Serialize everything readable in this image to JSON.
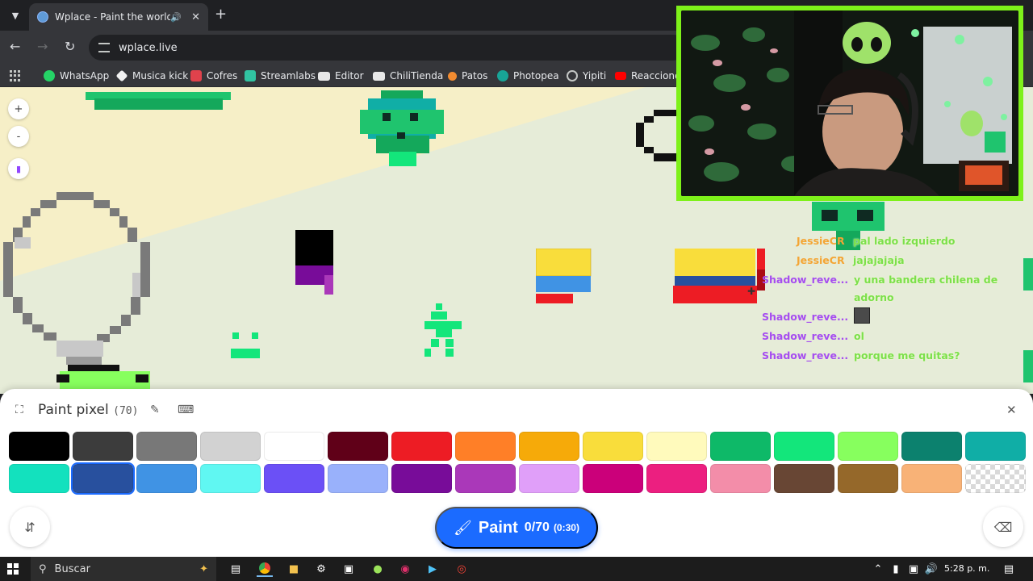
{
  "browser": {
    "tab_title": "Wplace - Paint the world",
    "url": "wplace.live"
  },
  "bookmarks": [
    {
      "label": "WhatsApp",
      "color": "#25d366"
    },
    {
      "label": "Musica kick",
      "color": "#f2f2f2"
    },
    {
      "label": "Cofres",
      "color": "#e0424c"
    },
    {
      "label": "Streamlabs",
      "color": "#31c3a2"
    },
    {
      "label": "Editor",
      "color": "#e8e8e8"
    },
    {
      "label": "ChiliTienda",
      "color": "#e8e8e8"
    },
    {
      "label": "Patos",
      "color": "#f28b30"
    },
    {
      "label": "Photopea",
      "color": "#18a497"
    },
    {
      "label": "Yipiti",
      "color": "#c4c7c5"
    },
    {
      "label": "Reacciones",
      "color": "#ff0000"
    }
  ],
  "map_controls": {
    "zoom_in": "+",
    "zoom_out": "-"
  },
  "chat": [
    {
      "user": "JessieCR",
      "text": "pal lado izquierdo",
      "color": "#f4a534"
    },
    {
      "user": "JessieCR",
      "text": "jajajajaja",
      "color": "#f4a534"
    },
    {
      "user": "Shadow_reve...",
      "text": "y una bandera chilena de",
      "text2": "adorno",
      "color": "#a64df0"
    },
    {
      "user": "Shadow_reve...",
      "text": "",
      "color": "#a64df0"
    },
    {
      "user": "Shadow_reve...",
      "text": "ol",
      "color": "#a64df0"
    },
    {
      "user": "Shadow_reve...",
      "text": "porque me quitas?",
      "color": "#a64df0"
    }
  ],
  "panel": {
    "title": "Paint pixel",
    "count": "(70)",
    "paint_label": "Paint",
    "paint_count": "0/70",
    "paint_time": "(0:30)"
  },
  "palette": [
    [
      "#000000",
      "#3c3c3c",
      "#787878",
      "#d2d2d2",
      "#ffffff",
      "#600018",
      "#ed1c24",
      "#ff7f27",
      "#f6aa09",
      "#f9dd3b",
      "#fffabc",
      "#0eb968",
      "#13e67b",
      "#87ff5e",
      "#0c816e",
      "#10aea6"
    ],
    [
      "#13e1be",
      "#28509e",
      "#4093e4",
      "#60f7f2",
      "#6b50f6",
      "#99b1fb",
      "#780c99",
      "#aa38b9",
      "#e09ff9",
      "#cb007a",
      "#ec1f80",
      "#f38da9",
      "#684634",
      "#95682a",
      "#f8b277",
      "transparent"
    ]
  ],
  "palette_selected": [
    1,
    1
  ],
  "taskbar": {
    "search_placeholder": "Buscar",
    "clock": "5:28 p. m."
  }
}
